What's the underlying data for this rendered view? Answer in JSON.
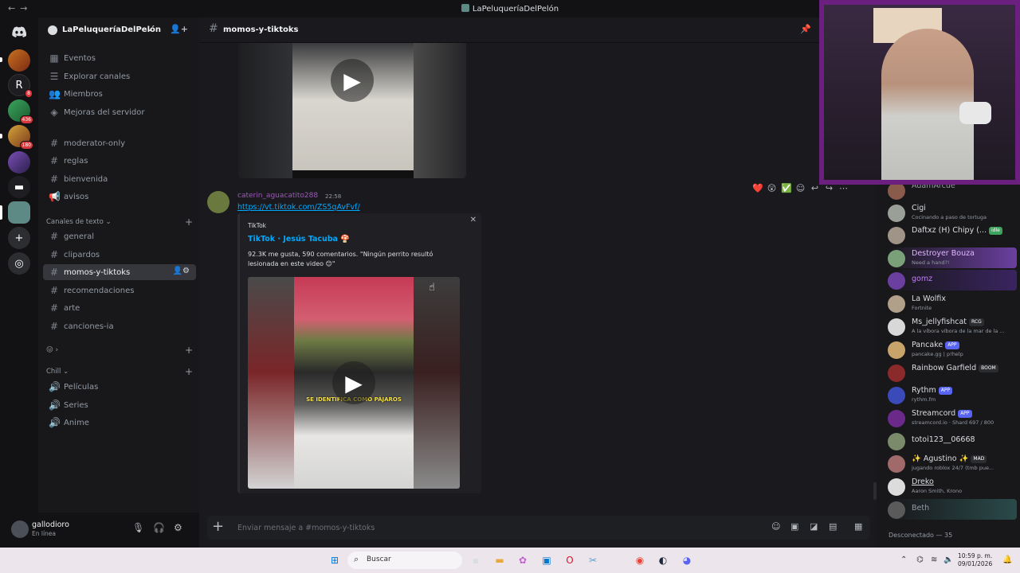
{
  "window": {
    "title": "LaPeluqueríaDelPelón",
    "nav_back": "←",
    "nav_forward": "→"
  },
  "guild_rail": {
    "badges": [
      "8",
      "436",
      "180"
    ]
  },
  "server": {
    "name": "LaPeluqueríaDelPelón",
    "dropdown": "⌄"
  },
  "sidebar": {
    "top_items": [
      {
        "label": "Eventos",
        "icon": "calendar-icon"
      },
      {
        "label": "Explorar canales",
        "icon": "compass-icon"
      },
      {
        "label": "Miembros",
        "icon": "members-icon"
      },
      {
        "label": "Mejoras del servidor",
        "icon": "boost-icon"
      }
    ],
    "channels_a": [
      "moderator-only",
      "reglas",
      "bienvenida",
      "avisos"
    ],
    "category_text": "Canales de texto",
    "channels_b": [
      "general",
      "clipardos",
      "momos-y-tiktoks",
      "recomendaciones",
      "arte",
      "canciones-ia"
    ],
    "active_channel": "momos-y-tiktoks",
    "category_emoji": "😛 ›",
    "category_chill": "Chill",
    "channels_c": [
      "Películas",
      "Series",
      "Anime"
    ]
  },
  "user": {
    "name": "gallodioro",
    "status": "En línea"
  },
  "channel_header": {
    "name": "momos-y-tiktoks"
  },
  "message": {
    "author": "caterin_aguacatito288",
    "time": "22:58",
    "link": "https://vt.tiktok.com/ZS5qAvFvf/",
    "embed": {
      "provider": "TikTok",
      "title": "TikTok · Jesús Tacuba 🍄",
      "description": "92.3K me gusta, 590 comentarios. \"Ningún perrito resultó lesionada en este video 😊\"",
      "video_caption": "SE IDENTIFICA COMO PÁJAROS"
    },
    "reactions": [
      "❤️",
      "😲",
      "✅"
    ]
  },
  "composer": {
    "placeholder": "Enviar mensaje a #momos-y-tiktoks"
  },
  "members": {
    "list": [
      {
        "name": "AdamArcue",
        "sub": "",
        "color": "#dbdee1"
      },
      {
        "name": "Cigi",
        "sub": "Cocinando a paso de tortuga",
        "color": "#dbdee1"
      },
      {
        "name": "Daftxz (H) Chipy (...",
        "sub": "",
        "tag": "idle",
        "color": "#dbdee1"
      },
      {
        "name": "Destroyer Bouza",
        "sub": "Need a hand?!",
        "color": "#c27cf5"
      },
      {
        "name": "gomz",
        "sub": "",
        "color": "#c27cf5"
      },
      {
        "name": "La Wolfix",
        "sub": "Fortnite",
        "color": "#dbdee1"
      },
      {
        "name": "Ms_jellyfishcat",
        "sub": "A la víbora víbora de la mar de la ...",
        "tag": "RCG",
        "color": "#dbdee1"
      },
      {
        "name": "Pancake",
        "sub": "pancake.gg | p!help",
        "tag": "APP",
        "color": "#dbdee1"
      },
      {
        "name": "Rainbow Garfield",
        "sub": "",
        "tag": "BOOM",
        "color": "#dbdee1"
      },
      {
        "name": "Rythm",
        "sub": "rythm.fm",
        "tag": "APP",
        "color": "#dbdee1"
      },
      {
        "name": "Streamcord",
        "sub": "streamcord.io · Shard 697 / 800",
        "tag": "APP",
        "color": "#dbdee1"
      },
      {
        "name": "totoi123__06668",
        "sub": "",
        "color": "#dbdee1"
      },
      {
        "name": "✨ Agustino ✨",
        "sub": "jugando roblox 24/7 (tmb pue...",
        "tag": "MAD",
        "color": "#dbdee1"
      },
      {
        "name": "Dreko",
        "sub": "Aaron Smith, Krono",
        "color": "#dbdee1"
      },
      {
        "name": "Beth",
        "sub": "",
        "color": "#949ba4"
      }
    ],
    "offline_label": "Desconectado — 35"
  },
  "taskbar": {
    "search": "Buscar",
    "time": "10:59 p. m.",
    "date": "09/01/2026"
  }
}
